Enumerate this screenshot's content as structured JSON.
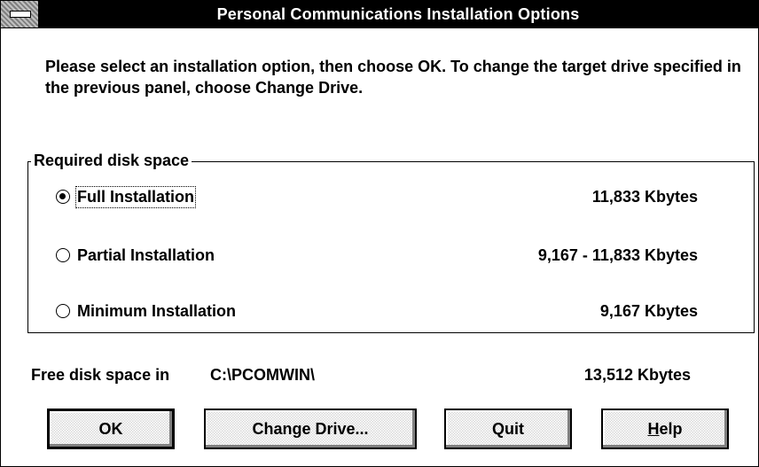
{
  "window": {
    "title": "Personal Communications Installation Options"
  },
  "intro_text": "Please select an installation option, then choose OK.  To change the target drive specified in the previous panel, choose Change Drive.",
  "group": {
    "label": "Required disk space",
    "options": [
      {
        "label": "Full Installation",
        "size": "11,833 Kbytes",
        "selected": true
      },
      {
        "label": "Partial Installation",
        "size": "9,167 - 11,833 Kbytes",
        "selected": false
      },
      {
        "label": "Minimum Installation",
        "size": "9,167 Kbytes",
        "selected": false
      }
    ]
  },
  "free_space": {
    "label": "Free disk space in",
    "path": "C:\\PCOMWIN\\",
    "size": "13,512 Kbytes"
  },
  "buttons": {
    "ok": "OK",
    "change_drive": "Change Drive...",
    "quit": "Quit",
    "help_prefix": "",
    "help_mnemonic": "H",
    "help_rest": "elp"
  }
}
